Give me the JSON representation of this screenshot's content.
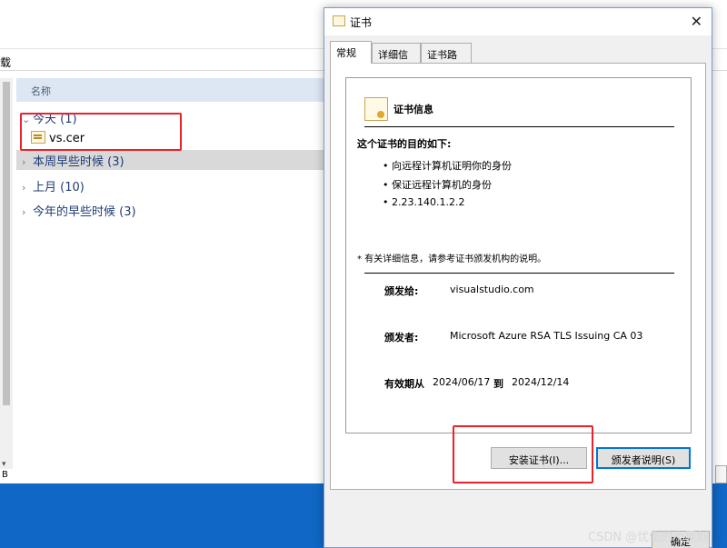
{
  "explorer": {
    "address_fragment": "载",
    "column_header": "名称",
    "groups": [
      {
        "label": "今天 (1)",
        "expanded": true
      },
      {
        "label": "本周早些时候 (3)",
        "expanded": false
      },
      {
        "label": "上月 (10)",
        "expanded": false
      },
      {
        "label": "今年的早些时候 (3)",
        "expanded": false
      }
    ],
    "file": {
      "name": "vs.cer",
      "icon": "certificate-file-icon"
    },
    "status_fragment": "B"
  },
  "dialog": {
    "title": "证书",
    "close_glyph": "✕",
    "tabs": [
      {
        "label": "常规",
        "active": true
      },
      {
        "label": "详细信息",
        "active": false
      },
      {
        "label": "证书路径",
        "active": false
      }
    ],
    "cert_info_title": "证书信息",
    "purpose_heading": "这个证书的目的如下:",
    "purposes": [
      "• 向远程计算机证明你的身份",
      "• 保证远程计算机的身份",
      "• 2.23.140.1.2.2"
    ],
    "note": "* 有关详细信息，请参考证书颁发机构的说明。",
    "issued_to_label": "颁发给:",
    "issued_to_value": "visualstudio.com",
    "issued_by_label": "颁发者:",
    "issued_by_value": "Microsoft Azure RSA TLS Issuing CA 03",
    "validity_label": "有效期从",
    "valid_from": "2024/06/17",
    "valid_to_word": "到",
    "valid_to": "2024/12/14",
    "install_button": "安装证书(I)...",
    "issuer_statement_button": "颁发者说明(S)",
    "ok_button": "确定"
  },
  "watermark": "CSDN @忧伤的小晃剑",
  "colors": {
    "highlight_red": "#e8232c",
    "group_text": "#1e3c78",
    "desktop_blue": "#1067c5"
  }
}
